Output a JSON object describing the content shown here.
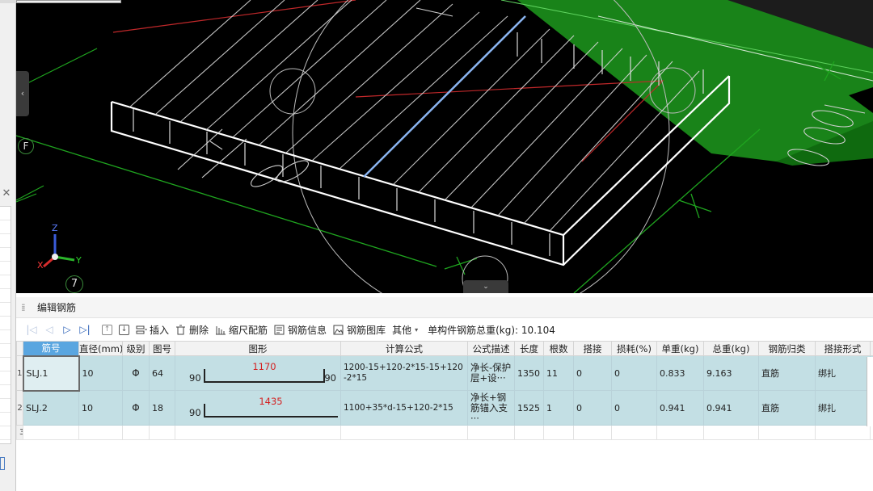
{
  "viewport": {
    "axis_letter_z": "Z",
    "axis_letter_y": "Y",
    "axis_letter_x": "X",
    "grid_label_f": "F",
    "grid_label_7": "7",
    "colors": {
      "background": "#000000",
      "slab_outline": "#ffffff",
      "green_beam": "#1a8a1a",
      "grid_line": "#1fa51f",
      "red_line": "#c0282a",
      "highlight_bar": "#8ab4f0"
    }
  },
  "panel": {
    "title": "编辑钢筋",
    "grip_icon": "grip-dots-icon"
  },
  "toolbar": {
    "insert_label": "插入",
    "delete_label": "删除",
    "scale_rebar_label": "缩尺配筋",
    "rebar_info_label": "钢筋信息",
    "rebar_library_label": "钢筋图库",
    "other_label": "其他",
    "total_weight_label": "单构件钢筋总重(kg):",
    "total_weight_value": "10.104"
  },
  "table": {
    "columns": [
      "筋号",
      "直径(mm)",
      "级别",
      "图号",
      "图形",
      "计算公式",
      "公式描述",
      "长度",
      "根数",
      "搭接",
      "损耗(%)",
      "单重(kg)",
      "总重(kg)",
      "钢筋归类",
      "搭接形式"
    ],
    "rows": [
      {
        "row_number": "1",
        "bar_no": "SLJ.1",
        "diameter": "10",
        "grade": "Φ",
        "shape_no": "64",
        "shape_left": "90",
        "shape_mid": "1170",
        "shape_right": "90",
        "formula": "1200-15+120-2*15-15+120-2*15",
        "description": "净长-保护层+设···",
        "length": "1350",
        "count": "11",
        "lap": "0",
        "loss": "0",
        "unit_weight": "0.833",
        "total_weight": "9.163",
        "category": "直筋",
        "lap_type": "绑扎"
      },
      {
        "row_number": "2",
        "bar_no": "SLJ.2",
        "diameter": "10",
        "grade": "Φ",
        "shape_no": "18",
        "shape_left": "90",
        "shape_mid": "1435",
        "formula": "1100+35*d-15+120-2*15",
        "description": "净长+钢筋锚入支···",
        "length": "1525",
        "count": "1",
        "lap": "0",
        "loss": "0",
        "unit_weight": "0.941",
        "total_weight": "0.941",
        "category": "直筋",
        "lap_type": "绑扎"
      }
    ],
    "empty_row_number": "3"
  }
}
